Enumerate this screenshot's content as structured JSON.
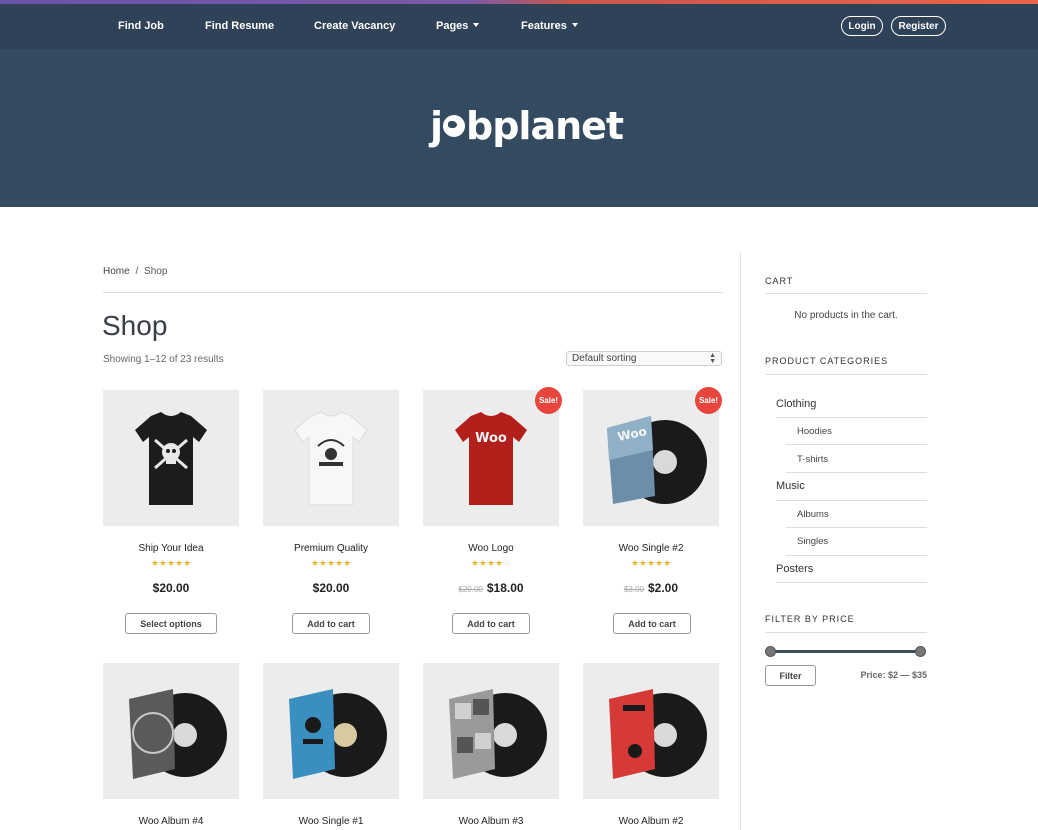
{
  "nav": {
    "items": [
      {
        "label": "Find Job",
        "dropdown": false
      },
      {
        "label": "Find Resume",
        "dropdown": false
      },
      {
        "label": "Create Vacancy",
        "dropdown": false
      },
      {
        "label": "Pages",
        "dropdown": true
      },
      {
        "label": "Features",
        "dropdown": true
      }
    ],
    "login_label": "Login",
    "register_label": "Register"
  },
  "hero": {
    "logo_before": "j",
    "logo_after": "bplanet"
  },
  "breadcrumb": {
    "home": "Home",
    "separator": "/",
    "current": "Shop"
  },
  "shop": {
    "title": "Shop",
    "result_count": "Showing 1–12 of 23 results",
    "sort_value": "Default sorting"
  },
  "products": [
    {
      "name": "Ship Your Idea",
      "rating": 4.5,
      "stars": "★★★★",
      "star_half": "★",
      "old_price": "",
      "price": "$20.00",
      "button": "Select options",
      "sale": false,
      "image": "black-tshirt"
    },
    {
      "name": "Premium Quality",
      "rating": 4.5,
      "stars": "★★★★",
      "star_half": "★",
      "old_price": "",
      "price": "$20.00",
      "button": "Add to cart",
      "sale": false,
      "image": "white-tshirt"
    },
    {
      "name": "Woo Logo",
      "rating": 4,
      "stars": "★★★★",
      "star_half": "☆",
      "old_price": "$20.00",
      "price": "$18.00",
      "button": "Add to cart",
      "sale": true,
      "image": "red-tshirt"
    },
    {
      "name": "Woo Single #2",
      "rating": 4.5,
      "stars": "★★★★",
      "star_half": "★",
      "old_price": "$3.00",
      "price": "$2.00",
      "button": "Add to cart",
      "sale": true,
      "image": "vinyl-blue-grey"
    },
    {
      "name": "Woo Album #4",
      "image": "vinyl-dark"
    },
    {
      "name": "Woo Single #1",
      "image": "vinyl-blue"
    },
    {
      "name": "Woo Album #3",
      "image": "vinyl-grey"
    },
    {
      "name": "Woo Album #2",
      "image": "vinyl-red"
    }
  ],
  "sale_label": "Sale!",
  "sidebar": {
    "cart_title": "CART",
    "cart_empty": "No products in the cart.",
    "categories_title": "PRODUCT CATEGORIES",
    "categories": [
      {
        "label": "Clothing",
        "level": 0
      },
      {
        "label": "Hoodies",
        "level": 1
      },
      {
        "label": "T-shirts",
        "level": 1
      },
      {
        "label": "Music",
        "level": 0
      },
      {
        "label": "Albums",
        "level": 1
      },
      {
        "label": "Singles",
        "level": 1
      },
      {
        "label": "Posters",
        "level": 0
      }
    ],
    "filter_title": "FILTER BY PRICE",
    "filter_button": "Filter",
    "price_label": "Price: $2 — $35"
  }
}
